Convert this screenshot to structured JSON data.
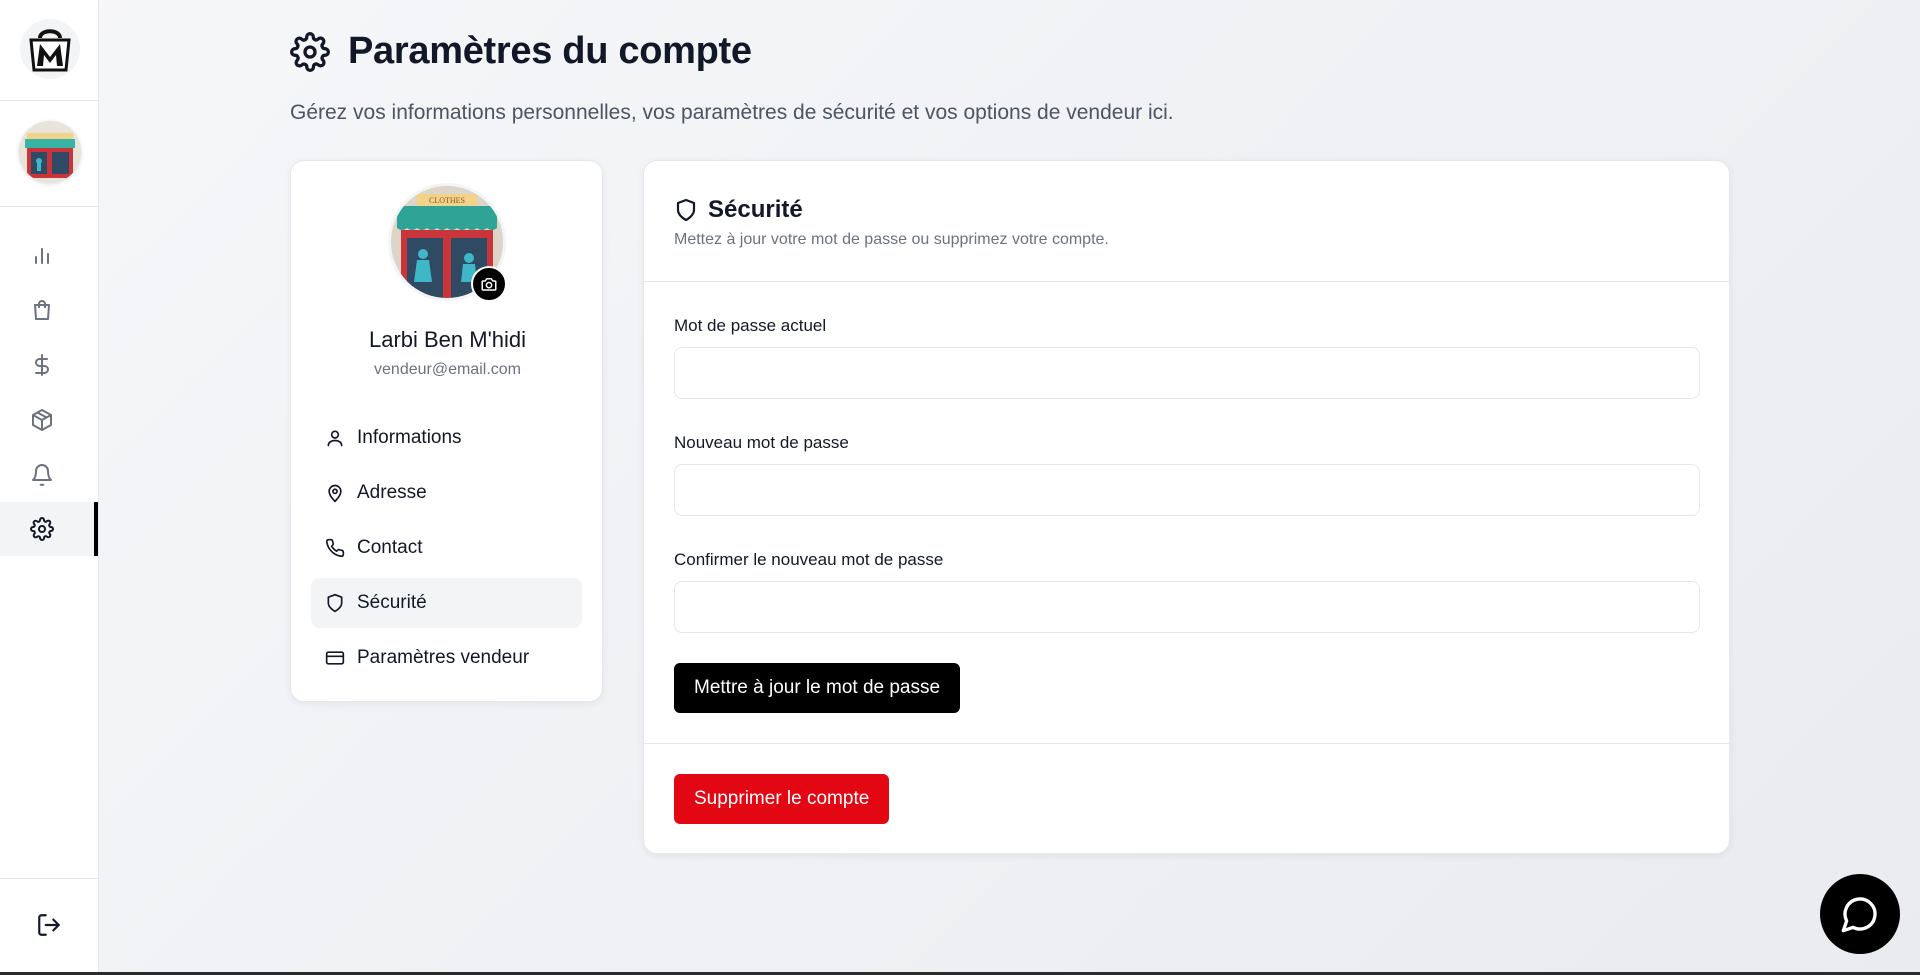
{
  "sidebar": {
    "items": [
      {
        "name": "analytics",
        "icon": "bar-chart-icon"
      },
      {
        "name": "orders",
        "icon": "shopping-bag-icon"
      },
      {
        "name": "finance",
        "icon": "dollar-icon"
      },
      {
        "name": "products",
        "icon": "package-icon"
      },
      {
        "name": "notifications",
        "icon": "bell-icon"
      },
      {
        "name": "settings",
        "icon": "gear-icon",
        "active": true
      }
    ],
    "logout_icon": "logout-icon"
  },
  "header": {
    "title": "Paramètres du compte",
    "subtitle": "Gérez vos informations personnelles, vos paramètres de sécurité et vos options de vendeur ici."
  },
  "profile": {
    "name": "Larbi Ben M'hidi",
    "email": "vendeur@email.com",
    "store_sign": "CLOTHES",
    "menu": [
      {
        "label": "Informations",
        "icon": "user-icon"
      },
      {
        "label": "Adresse",
        "icon": "map-pin-icon"
      },
      {
        "label": "Contact",
        "icon": "phone-icon"
      },
      {
        "label": "Sécurité",
        "icon": "shield-icon",
        "active": true
      },
      {
        "label": "Paramètres vendeur",
        "icon": "credit-card-icon"
      }
    ]
  },
  "security": {
    "title": "Sécurité",
    "description": "Mettez à jour votre mot de passe ou supprimez votre compte.",
    "fields": [
      {
        "label": "Mot de passe actuel",
        "value": ""
      },
      {
        "label": "Nouveau mot de passe",
        "value": ""
      },
      {
        "label": "Confirmer le nouveau mot de passe",
        "value": ""
      }
    ],
    "update_button": "Mettre à jour le mot de passe",
    "delete_button": "Supprimer le compte"
  },
  "colors": {
    "primary": "#000000",
    "danger": "#e30613",
    "muted_text": "#6b7280",
    "active_bg": "#f3f4f6"
  }
}
